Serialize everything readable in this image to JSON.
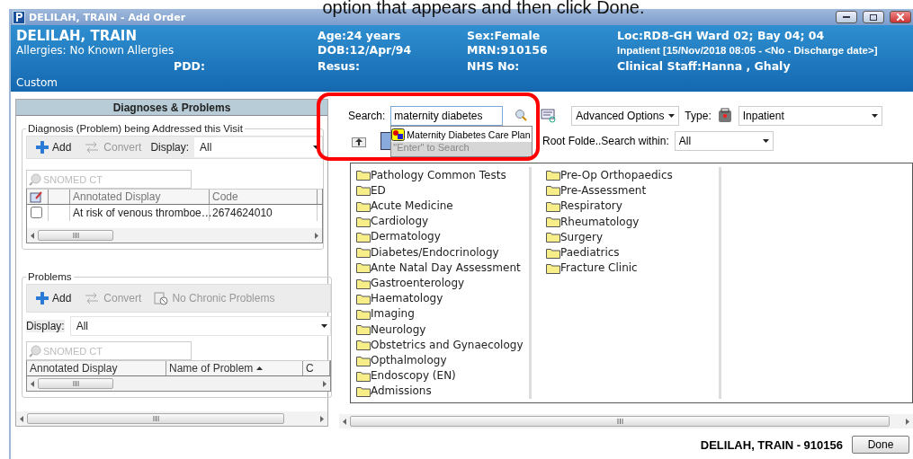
{
  "caption": "option that appears and then click Done.",
  "window": {
    "title": "DELILAH, TRAIN  - Add Order"
  },
  "banner": {
    "name": "DELILAH, TRAIN",
    "allergies": "Allergies: No Known Allergies",
    "pdd": "PDD:",
    "age": "Age:24 years",
    "dob": "DOB:12/Apr/94",
    "resus": "Resus:",
    "sex": "Sex:Female",
    "mrn": "MRN:910156",
    "nhs": "NHS No:",
    "loc": "Loc:RD8-GH Ward 02; Bay 04; 04",
    "encounter": "Inpatient [15/Nov/2018 08:05 - <No - Discharge date>]",
    "staff": "Clinical Staff:Hanna , Ghaly",
    "custom": "Custom"
  },
  "left_panel": {
    "title": "Diagnoses & Problems",
    "diagnosis": {
      "legend": "Diagnosis (Problem) being Addressed this Visit",
      "add": "Add",
      "convert": "Convert",
      "display_label": "Display:",
      "display_value": "All",
      "search_placeholder": "SNOMED CT",
      "columns": [
        "Annotated Display",
        "Code"
      ],
      "rows": [
        {
          "checked": false,
          "display": "At risk of venous thromboe…",
          "code": "2674624010"
        }
      ]
    },
    "problems": {
      "legend": "Problems",
      "add": "Add",
      "convert": "Convert",
      "no_chronic": "No Chronic Problems",
      "display_label": "Display:",
      "display_value": "All",
      "search_placeholder": "SNOMED CT",
      "columns": [
        "Annotated Display",
        "Name of Problem",
        "C"
      ]
    }
  },
  "search": {
    "label": "Search:",
    "value": "maternity diabetes",
    "suggestion": "Maternity Diabetes Care Plan",
    "hint": "\"Enter\" to Search",
    "advanced": "Advanced Options",
    "type_label": "Type:",
    "type_value": "Inpatient",
    "breadcrumb": "Root Folde..Search within:",
    "within_value": "All"
  },
  "folders": [
    [
      "Pathology Common Tests",
      "ED",
      "Acute Medicine",
      "Cardiology",
      "Dermatology",
      "Diabetes/Endocrinology",
      "Ante Natal Day Assessment",
      "Gastroenterology",
      "Haematology",
      "Imaging",
      "Neurology",
      "Obstetrics and Gynaecology",
      "Opthalmology",
      "Endoscopy (EN)",
      "Admissions"
    ],
    [
      "Pre-Op Orthopaedics",
      "Pre-Assessment",
      "Respiratory",
      "Rheumatology",
      "Surgery",
      "Paediatrics",
      "Fracture Clinic"
    ]
  ],
  "footer": {
    "patient": "DELILAH, TRAIN  - 910156",
    "done": "Done"
  }
}
